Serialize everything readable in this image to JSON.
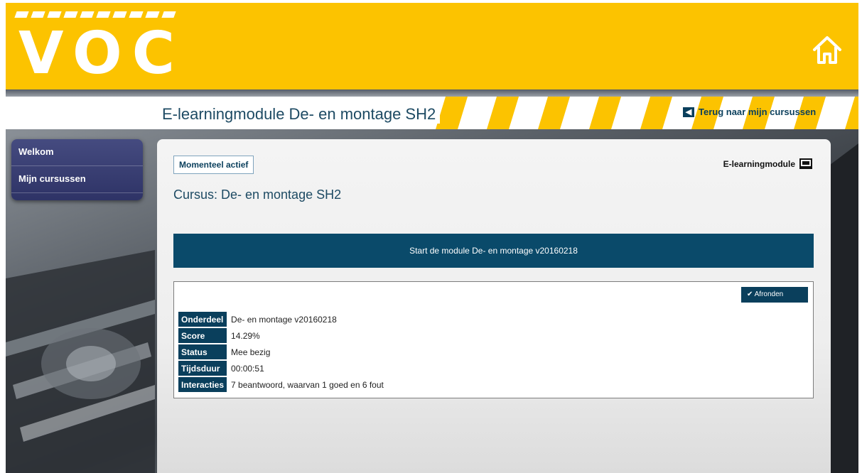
{
  "header": {
    "logo": "VOC",
    "home_icon": "home-icon"
  },
  "titlebar": {
    "title": "E-learningmodule De- en montage SH2",
    "back_link": "Terug naar mijn cursussen",
    "back_icon": "arrow-left-icon"
  },
  "sidebar": {
    "items": [
      {
        "label": "Welkom"
      },
      {
        "label": "Mijn cursussen"
      }
    ]
  },
  "main": {
    "status": "Momenteel actief",
    "module_label": "E-learningmodule",
    "module_icon": "module-icon",
    "course_title": "Cursus: De- en montage SH2",
    "start_button": "Start de module De- en montage v20160218",
    "complete_button": "Afronden",
    "info": [
      {
        "key": "Onderdeel",
        "value": "De- en montage v20160218"
      },
      {
        "key": "Score",
        "value": "14.29%"
      },
      {
        "key": "Status",
        "value": "Mee bezig"
      },
      {
        "key": "Tijdsduur",
        "value": "00:00:51"
      },
      {
        "key": "Interacties",
        "value": "7 beantwoord, waarvan 1 goed en 6 fout"
      }
    ]
  },
  "colors": {
    "brand_yellow": "#fcc300",
    "primary_blue": "#0a4a6a",
    "sidebar_purple": "#3a3f73"
  }
}
